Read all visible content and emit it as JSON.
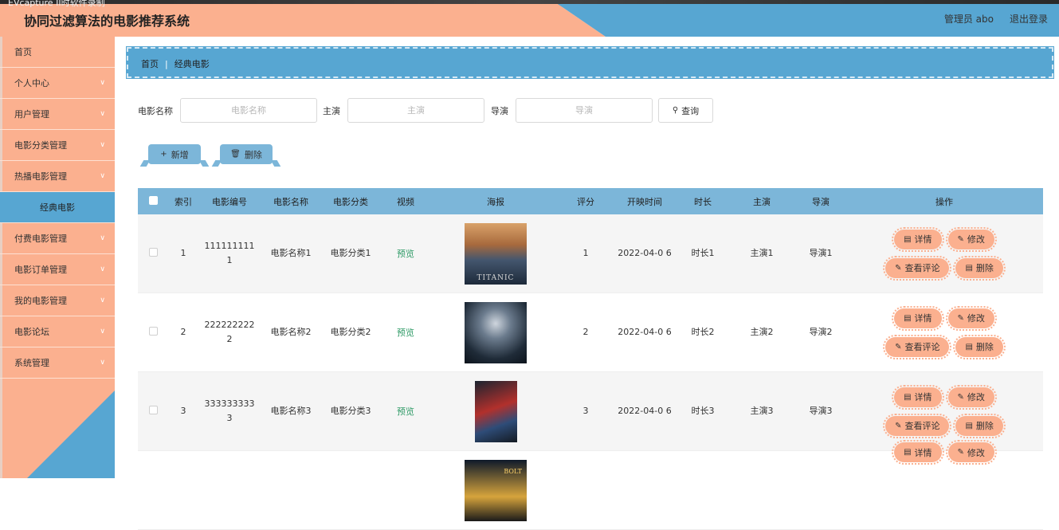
{
  "window": {
    "capture_text": "EVcapture II时软件录制"
  },
  "header": {
    "title": "协同过滤算法的电影推荐系统",
    "user": "管理员 abo",
    "logout": "退出登录"
  },
  "sidebar": {
    "items": [
      {
        "label": "首页",
        "has_chevron": false
      },
      {
        "label": "个人中心",
        "has_chevron": true
      },
      {
        "label": "用户管理",
        "has_chevron": true
      },
      {
        "label": "电影分类管理",
        "has_chevron": true
      },
      {
        "label": "热播电影管理",
        "has_chevron": true
      },
      {
        "label": "经典电影",
        "sub": true
      },
      {
        "label": "付费电影管理",
        "has_chevron": true
      },
      {
        "label": "电影订单管理",
        "has_chevron": true
      },
      {
        "label": "我的电影管理",
        "has_chevron": true
      },
      {
        "label": "电影论坛",
        "has_chevron": true
      },
      {
        "label": "系统管理",
        "has_chevron": true
      }
    ],
    "chevron": "∨"
  },
  "breadcrumb": {
    "home": "首页",
    "current": "经典电影"
  },
  "search": {
    "name_label": "电影名称",
    "name_placeholder": "电影名称",
    "actor_label": "主演",
    "actor_placeholder": "主演",
    "director_label": "导演",
    "director_placeholder": "导演",
    "button": "查询"
  },
  "actions": {
    "add": "新增",
    "delete": "删除"
  },
  "table": {
    "headers": [
      "索引",
      "电影编号",
      "电影名称",
      "电影分类",
      "视频",
      "海报",
      "评分",
      "开映时间",
      "时长",
      "主演",
      "导演",
      "操作"
    ],
    "rows": [
      {
        "index": "1",
        "code": "111111111 1",
        "name": "电影名称1",
        "category": "电影分类1",
        "video": "预览",
        "poster": "TITANIC",
        "rating": "1",
        "date": "2022-04-0 6",
        "duration": "时长1",
        "actor": "主演1",
        "director": "导演1"
      },
      {
        "index": "2",
        "code": "222222222 2",
        "name": "电影名称2",
        "category": "电影分类2",
        "video": "预览",
        "poster": "",
        "rating": "2",
        "date": "2022-04-0 6",
        "duration": "时长2",
        "actor": "主演2",
        "director": "导演2"
      },
      {
        "index": "3",
        "code": "333333333 3",
        "name": "电影名称3",
        "category": "电影分类3",
        "video": "预览",
        "poster": "",
        "rating": "3",
        "date": "2022-04-0 6",
        "duration": "时长3",
        "actor": "主演3",
        "director": "导演3"
      },
      {
        "index": "",
        "code": "",
        "name": "",
        "category": "",
        "video": "",
        "poster": "BOLT",
        "rating": "",
        "date": "",
        "duration": "",
        "actor": "",
        "director": ""
      }
    ],
    "op_labels": {
      "detail": "详情",
      "edit": "修改",
      "reviews": "查看评论",
      "delete": "删除"
    }
  },
  "colors": {
    "salmon": "#fbb08f",
    "blue": "#57a6d2",
    "header_blue": "#7cb6d9",
    "preview_green": "#2e9a66"
  }
}
